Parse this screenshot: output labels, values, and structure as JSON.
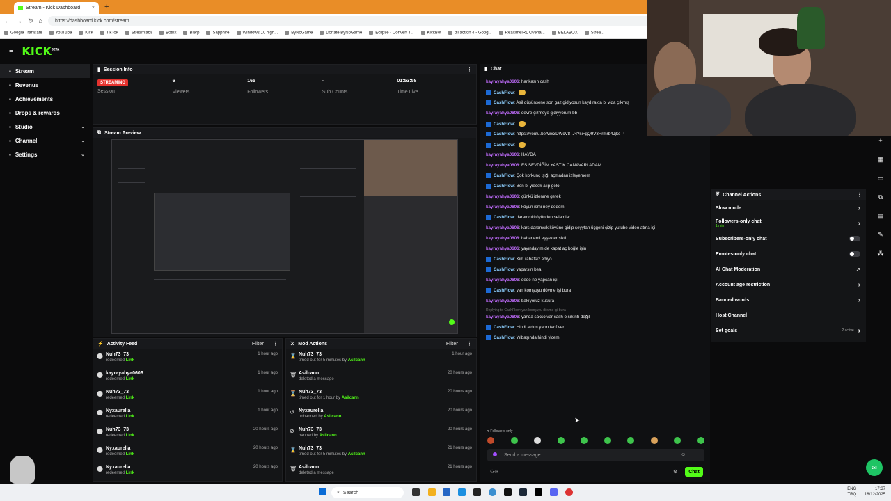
{
  "browser": {
    "tab_title": "Stream - Kick Dashboard",
    "url": "https://dashboard.kick.com/stream",
    "bookmarks": [
      "Google Translate",
      "YouTube",
      "Kick",
      "TikTok",
      "Streamlabs",
      "Botrix",
      "Blerp",
      "Sapphire",
      "Windows 10 high...",
      "ByNoGame",
      "Donate ByNoGame",
      "Eclipse - Convert T...",
      "KickBot",
      "dji action 4 - Goog...",
      "RealtimeIRL Overla...",
      "BELABOX",
      "Strea..."
    ]
  },
  "logo": "KICK",
  "logo_sup": "BETA",
  "sidebar": {
    "items": [
      {
        "label": "Stream",
        "active": true
      },
      {
        "label": "Revenue"
      },
      {
        "label": "Achievements"
      },
      {
        "label": "Drops & rewards"
      },
      {
        "label": "Studio",
        "chevron": "⌄"
      },
      {
        "label": "Channel",
        "chevron": "⌄"
      },
      {
        "label": "Settings",
        "chevron": "⌄"
      }
    ]
  },
  "session": {
    "title": "Session Info",
    "status": "STREAMING",
    "status_label": "Session",
    "viewers": "6",
    "viewers_label": "Viewers",
    "followers": "165",
    "followers_label": "Followers",
    "subs": "-",
    "subs_label": "Sub Counts",
    "time": "01:53:58",
    "time_label": "Time Live"
  },
  "preview": {
    "title": "Stream Preview"
  },
  "activity": {
    "title": "Activity Feed",
    "filter": "Filter",
    "rows": [
      {
        "name": "Nuh73_73",
        "sub": "redeemed",
        "link": "Link",
        "time": "1 hour ago"
      },
      {
        "name": "kayrayahya0606",
        "sub": "redeemed",
        "link": "Link",
        "time": "1 hour ago"
      },
      {
        "name": "Nuh73_73",
        "sub": "redeemed",
        "link": "Link",
        "time": "1 hour ago"
      },
      {
        "name": "Nyxaurelia",
        "sub": "redeemed",
        "link": "Link",
        "time": "1 hour ago"
      },
      {
        "name": "Nuh73_73",
        "sub": "redeemed",
        "link": "Link",
        "time": "20 hours ago"
      },
      {
        "name": "Nyxaurelia",
        "sub": "redeemed",
        "link": "Link",
        "time": "20 hours ago"
      },
      {
        "name": "Nyxaurelia",
        "sub": "redeemed",
        "link": "Link",
        "time": "20 hours ago"
      }
    ]
  },
  "mod": {
    "title": "Mod Actions",
    "filter": "Filter",
    "rows": [
      {
        "icon": "⌛",
        "name": "Nuh73_73",
        "sub": "timed out for 5 minutes by",
        "link": "Asilcann",
        "time": "1 hour ago"
      },
      {
        "icon": "🗑",
        "name": "Asilcann",
        "sub": "deleted a message",
        "link": "",
        "time": "20 hours ago"
      },
      {
        "icon": "⌛",
        "name": "Nuh73_73",
        "sub": "timed out for 1 hour by",
        "link": "Asilcann",
        "time": "20 hours ago"
      },
      {
        "icon": "↺",
        "name": "Nyxaurelia",
        "sub": "unbanned by",
        "link": "Asilcann",
        "time": "20 hours ago"
      },
      {
        "icon": "⊘",
        "name": "Nuh73_73",
        "sub": "banned by",
        "link": "Asilcann",
        "time": "20 hours ago"
      },
      {
        "icon": "⌛",
        "name": "Nuh73_73",
        "sub": "timed out for 5 minutes by",
        "link": "Asilcann",
        "time": "21 hours ago"
      },
      {
        "icon": "🗑",
        "name": "Asilcann",
        "sub": "deleted a message",
        "link": "",
        "time": "21 hours ago"
      }
    ]
  },
  "chat": {
    "title": "Chat",
    "messages": [
      {
        "user": "kayrayahya0606",
        "kind": "k",
        "text": "harikasın cash"
      },
      {
        "user": "CashFlow",
        "kind": "c",
        "text": "",
        "emote": true
      },
      {
        "user": "CashFlow",
        "kind": "c",
        "text": "Asil düşünsene son gaz gidiyosun kaydırakta bi vida çıkmış"
      },
      {
        "user": "kayrayahya0606",
        "kind": "k",
        "text": "devre çizmeye gidiyyorum bb"
      },
      {
        "user": "CashFlow",
        "kind": "c",
        "text": "",
        "emote": true
      },
      {
        "user": "CashFlow",
        "kind": "c",
        "text": "https://youtu.be/Wx3DWcV8_J4?si=gQ9V3Rrmrb4Jjkc P"
      },
      {
        "user": "CashFlow",
        "kind": "c",
        "text": "",
        "emote": true
      },
      {
        "user": "kayrayahya0606",
        "kind": "k",
        "text": "HAYDA"
      },
      {
        "user": "kayrayahya0606",
        "kind": "k",
        "text": "ES SEVDİĞİM YASTIK CANAVARI ADAM"
      },
      {
        "user": "CashFlow",
        "kind": "c",
        "text": "Çok korkunç işığı açmadan izleyemem"
      },
      {
        "user": "CashFlow",
        "kind": "c",
        "text": "Ben bi yiecek alıp gelo"
      },
      {
        "user": "kayrayahya0606",
        "kind": "k",
        "text": "çünkü izlenme gerek"
      },
      {
        "user": "kayrayahya0606",
        "kind": "k",
        "text": "köyün ismi ney dedem"
      },
      {
        "user": "CashFlow",
        "kind": "c",
        "text": "daramcıkköyünden selamlar"
      },
      {
        "user": "kayrayahya0606",
        "kind": "k",
        "text": "kars daramcık köyüne gidip şeyytan üçgeni çizip yutube video atma işi"
      },
      {
        "user": "kayrayahya0606",
        "kind": "k",
        "text": "babanemi eşşekler sikti"
      },
      {
        "user": "kayrayahya0606",
        "kind": "k",
        "text": "yayındayım de kapat aç boğle işin"
      },
      {
        "user": "CashFlow",
        "kind": "c",
        "text": "Kim rahatsız ediyo"
      },
      {
        "user": "CashFlow",
        "kind": "c",
        "text": "yaparsın bea"
      },
      {
        "user": "kayrayahya0606",
        "kind": "k",
        "text": "dede ne yapcan işi"
      },
      {
        "user": "CashFlow",
        "kind": "c",
        "text": "yan komşuyu dövme işi bura"
      },
      {
        "user": "kayrayahya0606",
        "kind": "k",
        "text": "bakıyoruz kusura"
      },
      {
        "user": "kayrayahya0606",
        "kind": "k",
        "text": "yanda sakso var cash o sıkıntı değil",
        "reply": "Replying to CashFlow: yan komşuyu dövme işi bura"
      },
      {
        "user": "CashFlow",
        "kind": "c",
        "text": "Hindi aldım yarın tarif ver"
      },
      {
        "user": "CashFlow",
        "kind": "c",
        "text": "Yılbaşında hindi yicem"
      }
    ],
    "followers_only": "Followers only",
    "placeholder": "Send a message",
    "send": "Chat"
  },
  "channel_actions": {
    "title": "Channel Actions",
    "items": [
      {
        "label": "Slow mode",
        "ctrl": "arrow"
      },
      {
        "label": "Followers-only chat",
        "sub": "1 min",
        "ctrl": "arrow"
      },
      {
        "label": "Subscribers-only chat",
        "ctrl": "toggle"
      },
      {
        "label": "Emotes-only chat",
        "ctrl": "toggle"
      },
      {
        "label": "AI Chat Moderation",
        "ctrl": "ext"
      },
      {
        "label": "Account age restriction",
        "ctrl": "arrow"
      },
      {
        "label": "Banned words",
        "ctrl": "arrow"
      },
      {
        "label": "Host Channel",
        "ctrl": "none"
      },
      {
        "label": "Set goals",
        "extra": "2 active",
        "ctrl": "arrow"
      }
    ]
  },
  "taskbar": {
    "search": "Search",
    "lang": "ENG",
    "region": "TRQ",
    "time": "17:37",
    "date": "18/12/2025"
  },
  "colors": {
    "brand": "#53fc18",
    "live": "#e5322e",
    "bg": "#0b0b0c"
  }
}
